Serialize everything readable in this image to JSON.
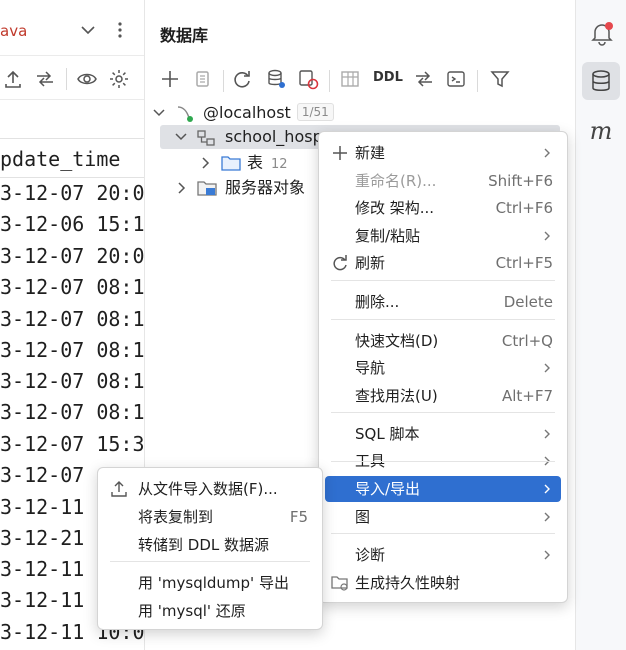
{
  "editor": {
    "tab_name": "ava",
    "column_header": "pdate_time",
    "rows": [
      "3-12-07 20:0",
      "3-12-06 15:1",
      "3-12-07 20:0",
      "3-12-07 08:1",
      "3-12-07 08:1",
      "3-12-07 08:1",
      "3-12-07 08:1",
      "3-12-07 08:1",
      "3-12-07 15:3",
      "3-12-07",
      "3-12-11",
      "3-12-21",
      "3-12-11",
      "3-12-11",
      "3-12-11 10:0"
    ]
  },
  "db_panel": {
    "title": "数据库",
    "toolbar": {
      "ddl_label": "DDL"
    },
    "tree": {
      "host": {
        "label": "@localhost",
        "badge": "1/51"
      },
      "schema": {
        "label": "school_hosp"
      },
      "tables": {
        "label": "表",
        "count": "12"
      },
      "server_objects": {
        "label": "服务器对象"
      }
    }
  },
  "context_menu": {
    "items": [
      {
        "label": "新建",
        "shortcut": "",
        "submenu": true,
        "disabled": false
      },
      {
        "label": "重命名(R)...",
        "shortcut": "Shift+F6",
        "submenu": false,
        "disabled": true
      },
      {
        "label": "修改 架构...",
        "shortcut": "Ctrl+F6",
        "submenu": false,
        "disabled": false
      },
      {
        "label": "复制/粘贴",
        "shortcut": "",
        "submenu": true,
        "disabled": false
      },
      {
        "label": "刷新",
        "shortcut": "Ctrl+F5",
        "submenu": false,
        "disabled": false
      },
      {
        "label": "删除...",
        "shortcut": "Delete",
        "submenu": false,
        "disabled": false
      },
      {
        "label": "快速文档(D)",
        "shortcut": "Ctrl+Q",
        "submenu": false,
        "disabled": false
      },
      {
        "label": "导航",
        "shortcut": "",
        "submenu": true,
        "disabled": false
      },
      {
        "label": "查找用法(U)",
        "shortcut": "Alt+F7",
        "submenu": false,
        "disabled": false
      },
      {
        "label": "SQL 脚本",
        "shortcut": "",
        "submenu": true,
        "disabled": false
      },
      {
        "label": "工具",
        "shortcut": "",
        "submenu": true,
        "disabled": false
      },
      {
        "label": "导入/导出",
        "shortcut": "",
        "submenu": true,
        "disabled": false,
        "active": true
      },
      {
        "label": "图",
        "shortcut": "",
        "submenu": true,
        "disabled": false
      },
      {
        "label": "诊断",
        "shortcut": "",
        "submenu": true,
        "disabled": false
      },
      {
        "label": "生成持久性映射",
        "shortcut": "",
        "submenu": false,
        "disabled": false
      }
    ]
  },
  "submenu": {
    "items": [
      {
        "label": "从文件导入数据(F)...",
        "shortcut": ""
      },
      {
        "label": "将表复制到",
        "shortcut": "F5"
      },
      {
        "label": "转储到 DDL 数据源",
        "shortcut": ""
      },
      {
        "label": "用 'mysqldump' 导出",
        "shortcut": ""
      },
      {
        "label": "用 'mysql' 还原",
        "shortcut": ""
      }
    ]
  },
  "right_strip": {
    "letter": "m"
  },
  "colors": {
    "accent": "#2f6fd0",
    "notification_dot": "#e5484d",
    "tab_text": "#c0392b"
  }
}
